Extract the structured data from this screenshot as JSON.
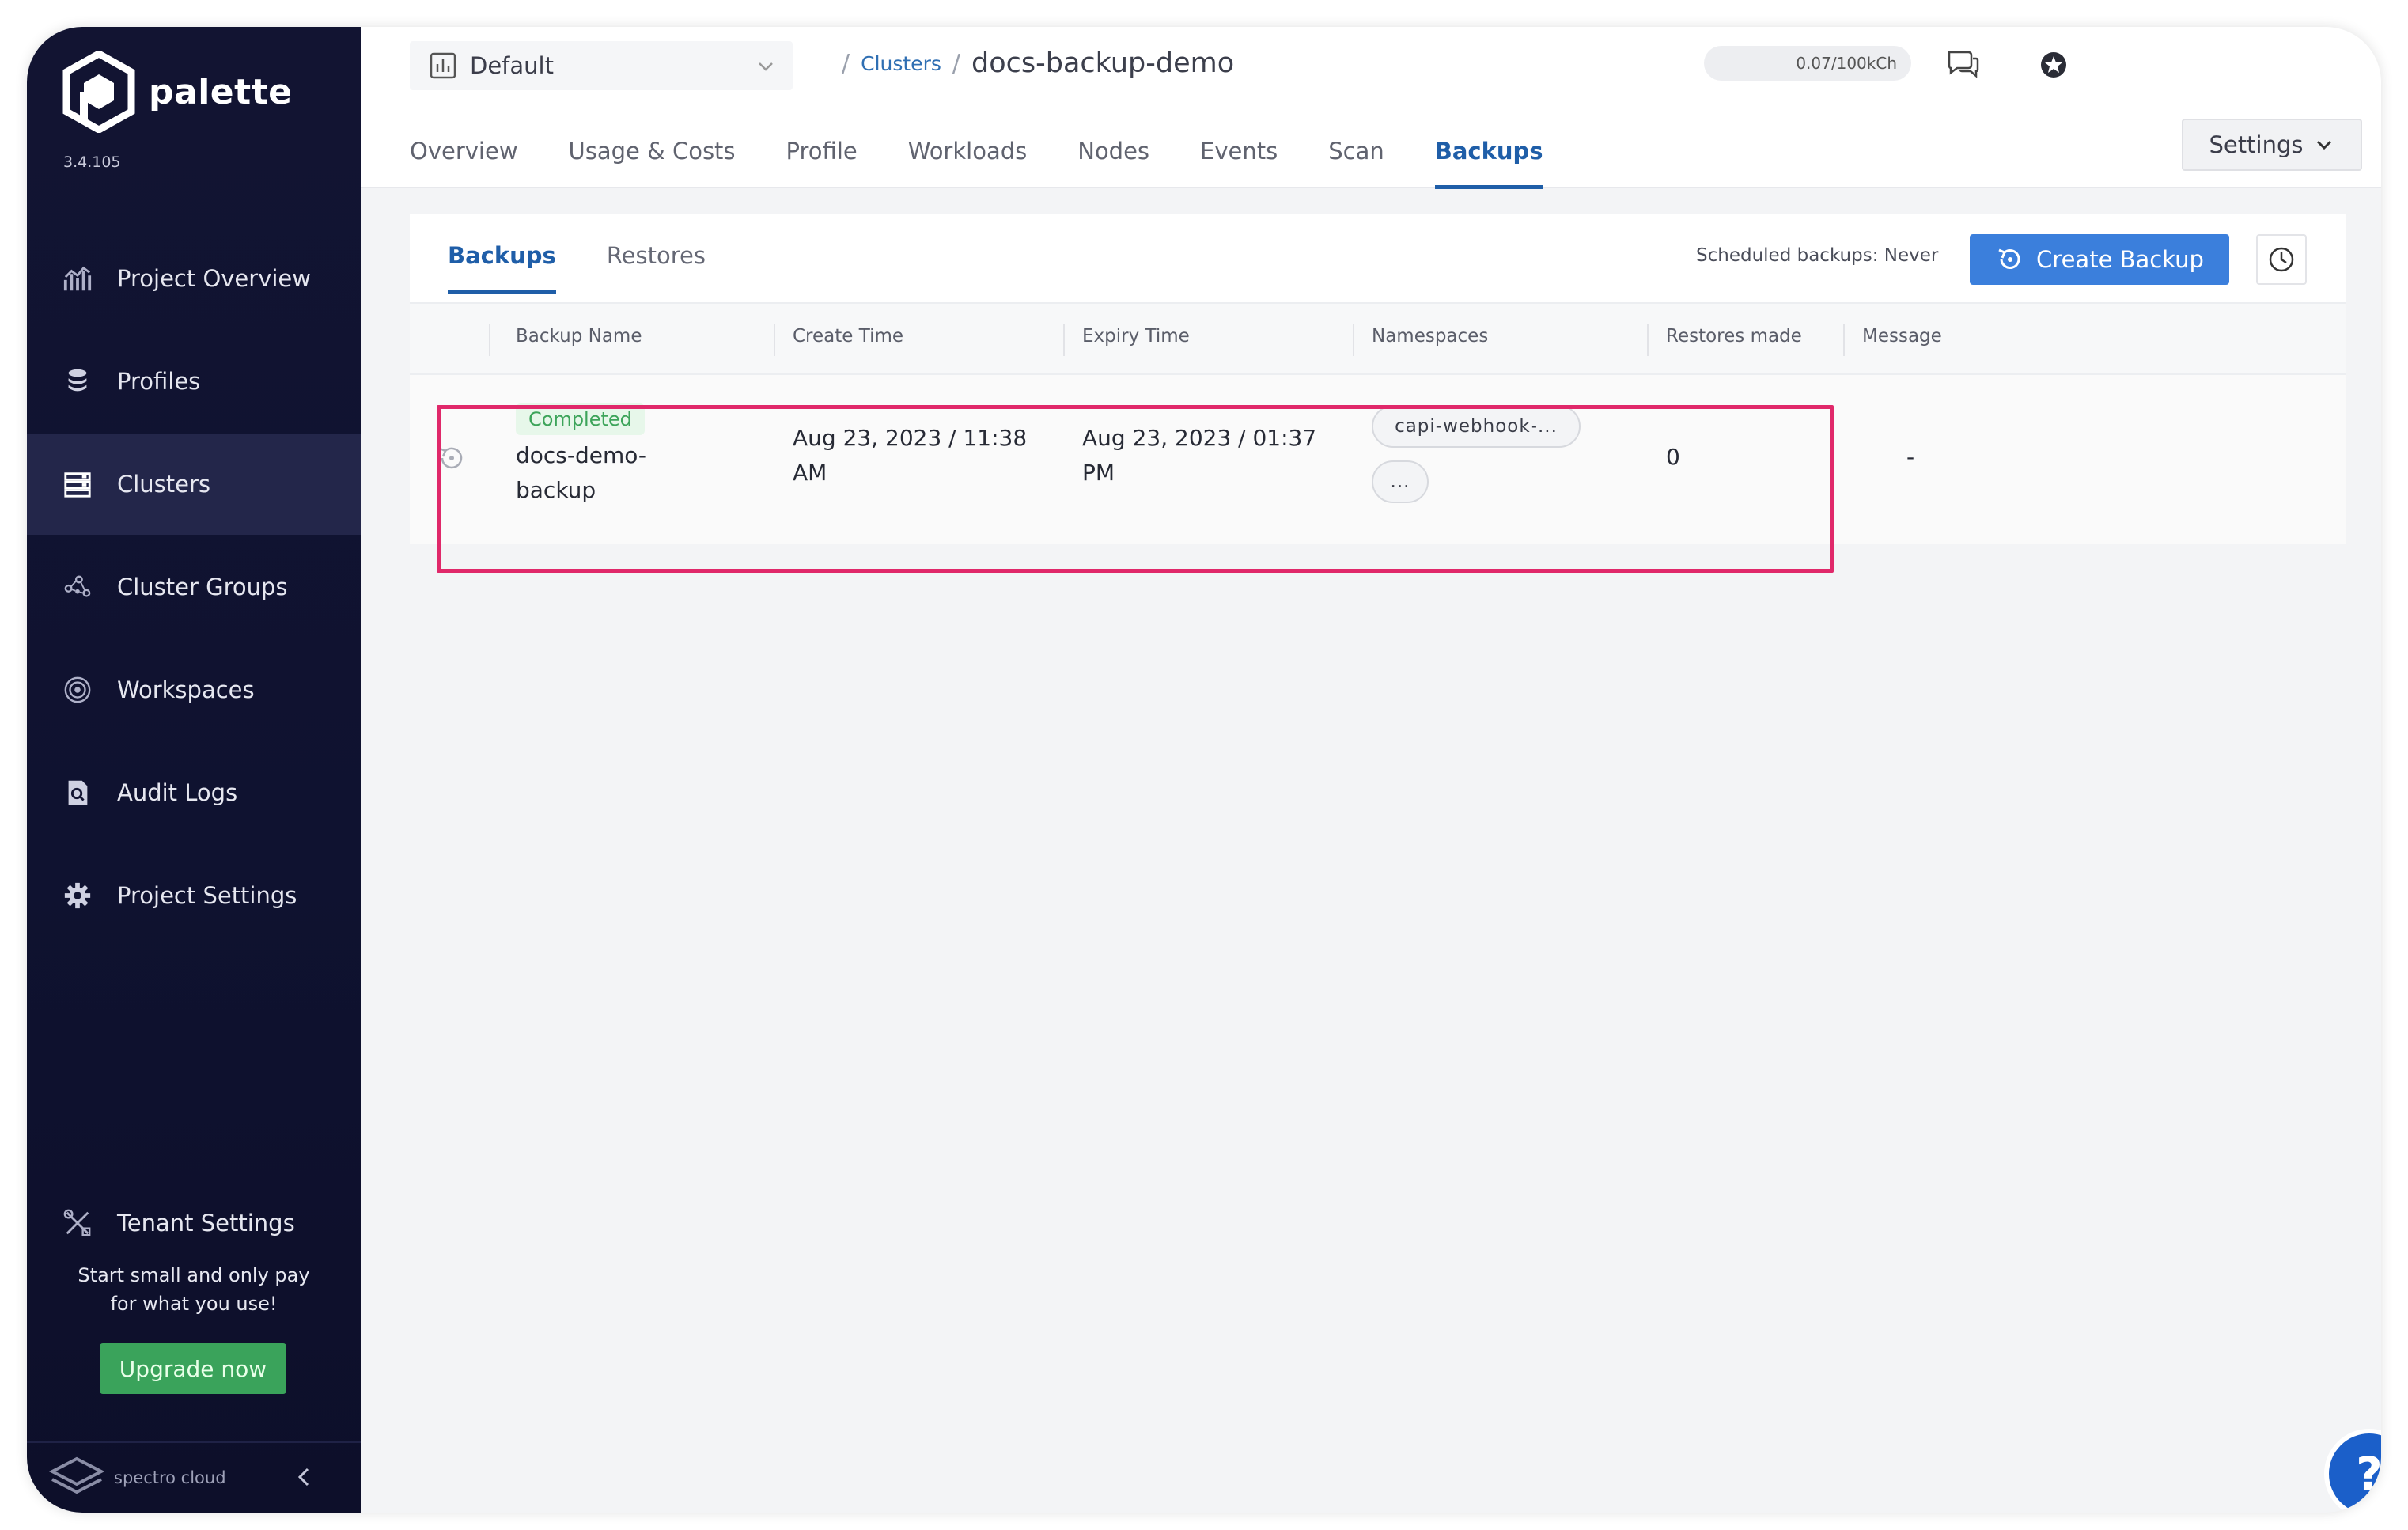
{
  "sidebar": {
    "brand": "palette",
    "version": "3.4.105",
    "items": [
      {
        "label": "Project Overview",
        "icon": "chart-icon"
      },
      {
        "label": "Profiles",
        "icon": "stack-icon"
      },
      {
        "label": "Clusters",
        "icon": "clusters-icon",
        "active": true
      },
      {
        "label": "Cluster Groups",
        "icon": "graph-icon"
      },
      {
        "label": "Workspaces",
        "icon": "target-icon"
      },
      {
        "label": "Audit Logs",
        "icon": "audit-icon"
      },
      {
        "label": "Project Settings",
        "icon": "gear-icon"
      }
    ],
    "tenant_settings": "Tenant Settings",
    "promo_line1": "Start small and only pay",
    "promo_line2": "for what you use!",
    "upgrade_label": "Upgrade now",
    "footer_brand": "spectro cloud"
  },
  "header": {
    "project": "Default",
    "breadcrumb_parent": "Clusters",
    "breadcrumb_sep": "/",
    "breadcrumb_current": "docs-backup-demo",
    "credits": "0.07/100kCh",
    "user_name": "▙▗ ▀▞ ▖▗▚ ▛▞▙▘▞▖▞▟▙▗ ▗"
  },
  "tabs": [
    "Overview",
    "Usage & Costs",
    "Profile",
    "Workloads",
    "Nodes",
    "Events",
    "Scan",
    "Backups"
  ],
  "active_tab": "Backups",
  "settings_label": "Settings",
  "backups": {
    "subtabs": [
      "Backups",
      "Restores"
    ],
    "scheduled": "Scheduled backups: Never",
    "create_label": "Create Backup",
    "columns": [
      "Backup Name",
      "Create Time",
      "Expiry Time",
      "Namespaces",
      "Restores made",
      "Message"
    ],
    "rows": [
      {
        "status": "Completed",
        "name_line1": "docs-demo-",
        "name_line2": "backup",
        "create_line1": "Aug 23, 2023 / 11:38",
        "create_line2": "AM",
        "expiry_line1": "Aug 23, 2023 / 01:37",
        "expiry_line2": "PM",
        "namespace": "capi-webhook-...",
        "namespace_more": "...",
        "restores": "0",
        "message": "-"
      }
    ]
  },
  "help_label": "?",
  "colors": {
    "sidebar_bg": "#121432",
    "accent": "#1f5ea8",
    "primary_button": "#3b7fdc",
    "success": "#3da45a",
    "highlight": "#e0286a"
  }
}
